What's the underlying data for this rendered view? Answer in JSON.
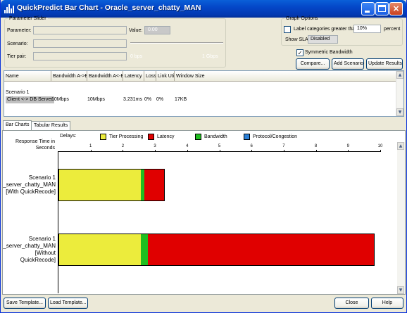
{
  "window": {
    "title": "QuickPredict Bar Chart - Oracle_server_chatty_MAN",
    "buttons": {
      "minimize": "minimize",
      "maximize": "maximize",
      "close": "×"
    }
  },
  "parameter_slider": {
    "legend": "Parameter Slider",
    "parameter_label": "Parameter:",
    "value_label": "Value:",
    "value": "0.00",
    "scenario_label": "Scenario:",
    "tier_pair_label": "Tier pair:",
    "range_min": "0 bps",
    "range_max": "1 Gbps"
  },
  "graph_options": {
    "legend": "Graph Options",
    "label_categories_label": "Label categories greater than",
    "label_categories_checked": false,
    "threshold": "10%",
    "percent_label": "percent",
    "show_sla_label": "Show SLA:",
    "show_sla_value": "Disabled",
    "symmetric_bandwidth_label": "Symmetric Bandwidth",
    "symmetric_bandwidth_checked": true,
    "compare_button": "Compare...",
    "add_scenario_button": "Add Scenario",
    "update_results_button": "Update Results"
  },
  "results_table": {
    "columns": [
      "Name",
      "Bandwidth A->B",
      "Bandwidth A<-B",
      "Latency",
      "Loss",
      "Link Util",
      "Window Size"
    ],
    "group": "Scenario 1",
    "rows": [
      {
        "name": "Client <-> DB Server",
        "bw_ab": "10Mbps",
        "bw_ba": "10Mbps",
        "latency": "3.231ms",
        "loss": "0%",
        "link_util": "0%",
        "window": "17KB"
      }
    ]
  },
  "tabs": [
    {
      "label": "Bar Charts",
      "active": true
    },
    {
      "label": "Tabular Results",
      "active": false
    }
  ],
  "chart_data": {
    "type": "bar",
    "orientation": "horizontal",
    "stacked": true,
    "delays_label": "Delays:",
    "xlabel": "Response Time in Seconds",
    "xlim": [
      0,
      10
    ],
    "ticks": [
      1,
      2,
      3,
      4,
      5,
      6,
      7,
      8,
      9,
      10
    ],
    "categories": [
      "Scenario 1\n_server_chatty_MAN\n[With QuickRecode]",
      "Scenario 1\n_server_chatty_MAN\n[Without\nQuickRecode]"
    ],
    "series": [
      {
        "name": "Tier Processing",
        "color": "#ecec3c",
        "values": [
          2.55,
          2.55
        ]
      },
      {
        "name": "Latency",
        "color": "#e00000",
        "values": [
          0.63,
          7.05
        ]
      },
      {
        "name": "Bandwidth",
        "color": "#1fbe1f",
        "values": [
          0.13,
          0.22
        ]
      },
      {
        "name": "Protocol/Congestion",
        "color": "#2b7fd6",
        "values": [
          0,
          0
        ]
      }
    ],
    "legend_order": [
      "Tier Processing",
      "Latency",
      "Bandwidth",
      "Protocol/Congestion"
    ],
    "segment_order": [
      "Tier Processing",
      "Bandwidth",
      "Latency"
    ]
  },
  "footer": {
    "save_template": "Save Template...",
    "load_template": "Load Template...",
    "close": "Close",
    "help": "Help"
  }
}
